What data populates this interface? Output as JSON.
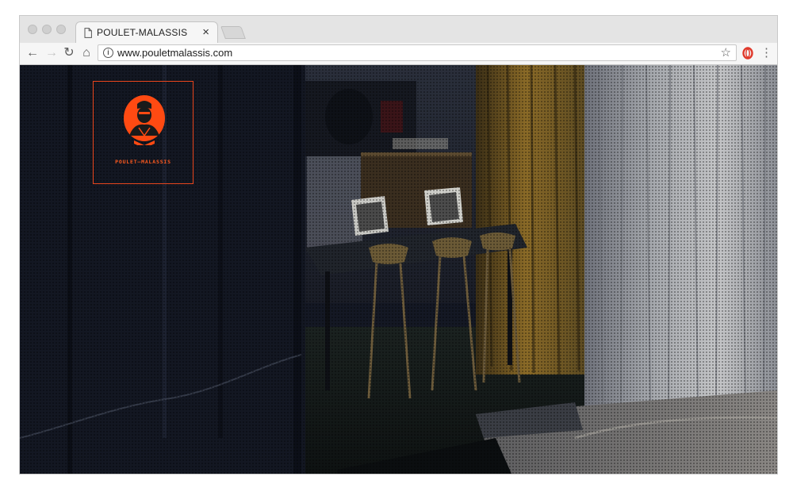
{
  "browser": {
    "tab": {
      "title": "POULET-MALASSIS",
      "close": "×"
    },
    "nav": {
      "back": "←",
      "forward": "→",
      "reload": "↻",
      "home": "⌂",
      "menu": "⋮"
    },
    "address_bar": {
      "info": "i",
      "url": "www.pouletmalassis.com",
      "bookmark": "☆"
    },
    "icons": [
      "page-icon",
      "back-icon",
      "forward-icon",
      "reload-icon",
      "home-icon",
      "info-icon",
      "star-icon",
      "extension-icon",
      "menu-icon"
    ]
  },
  "page": {
    "logo": {
      "label": "POULET–MALASSIS"
    },
    "colors": {
      "accent": "#e8451c",
      "background": "#121521"
    }
  }
}
